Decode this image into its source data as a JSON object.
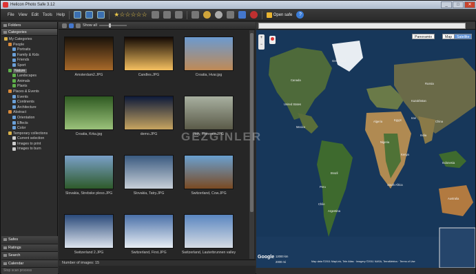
{
  "window": {
    "title": "Helicon Photo Safe 3.12",
    "buttons": [
      "_",
      "□",
      "✕"
    ]
  },
  "menu": [
    "File",
    "View",
    "Edit",
    "Tools",
    "Help"
  ],
  "toolbar": {
    "open_safe": "Open safe",
    "help": "?"
  },
  "left": {
    "folders_label": "Folders",
    "categories_label": "Categories",
    "tree": [
      {
        "label": "My Categories",
        "depth": 0,
        "color": "#d9b24a"
      },
      {
        "label": "People",
        "depth": 1,
        "color": "#d98a3a"
      },
      {
        "label": "Portraits",
        "depth": 2,
        "color": "#6aa0d8"
      },
      {
        "label": "Family & Kids",
        "depth": 2,
        "color": "#6aa0d8"
      },
      {
        "label": "Friends",
        "depth": 2,
        "color": "#6aa0d8"
      },
      {
        "label": "Sport",
        "depth": 2,
        "color": "#6aa0d8"
      },
      {
        "label": "Nature",
        "depth": 1,
        "color": "#5fb04a",
        "selected": true
      },
      {
        "label": "Landscapes",
        "depth": 2,
        "color": "#5fb04a"
      },
      {
        "label": "Animals",
        "depth": 2,
        "color": "#5fb04a"
      },
      {
        "label": "Plants",
        "depth": 2,
        "color": "#5fb04a"
      },
      {
        "label": "Places & Events",
        "depth": 1,
        "color": "#d98a3a"
      },
      {
        "label": "Events",
        "depth": 2,
        "color": "#6aa0d8"
      },
      {
        "label": "Continents",
        "depth": 2,
        "color": "#6aa0d8"
      },
      {
        "label": "Architecture",
        "depth": 2,
        "color": "#6aa0d8"
      },
      {
        "label": "Abstract",
        "depth": 1,
        "color": "#d98a3a"
      },
      {
        "label": "Orientation",
        "depth": 2,
        "color": "#6aa0d8"
      },
      {
        "label": "Effects",
        "depth": 2,
        "color": "#6aa0d8"
      },
      {
        "label": "Color",
        "depth": 2,
        "color": "#6aa0d8"
      },
      {
        "label": "Temporary collections",
        "depth": 1,
        "color": "#d9b24a"
      },
      {
        "label": "Current selection",
        "depth": 2,
        "color": "#cccccc"
      },
      {
        "label": "Images to print",
        "depth": 2,
        "color": "#cccccc"
      },
      {
        "label": "Images to burn",
        "depth": 2,
        "color": "#cccccc"
      }
    ],
    "bottom": [
      "Safes",
      "Ratings",
      "Search",
      "Calendar"
    ],
    "status": "Stop scan process"
  },
  "center": {
    "show_all": "Show all",
    "count_text": "Number of images: 15",
    "images": [
      {
        "caption": "Amsterdam2.JPG",
        "colors": [
          "#1a120a",
          "#a86a2a"
        ]
      },
      {
        "caption": "Candles.JPG",
        "colors": [
          "#120904",
          "#f5c060"
        ]
      },
      {
        "caption": "Croatia, Hvar.jpg",
        "colors": [
          "#6b9ad0",
          "#c08a55"
        ]
      },
      {
        "caption": "Croatia, Krka.jpg",
        "colors": [
          "#2f5a22",
          "#9bc27a"
        ]
      },
      {
        "caption": "demo.JPG",
        "colors": [
          "#0d1a3a",
          "#c7a560"
        ]
      },
      {
        "caption": "Italy, Florence.JPG",
        "colors": [
          "#a8b0a0",
          "#5a5a48"
        ]
      },
      {
        "caption": "Slovakia, Strebske pleso.JPG",
        "colors": [
          "#7aa0c8",
          "#2e5a2a"
        ]
      },
      {
        "caption": "Slovakia, Tatry.JPG",
        "colors": [
          "#3a5a80",
          "#c8d0d8"
        ]
      },
      {
        "caption": "Switzerland, Cow.JPG",
        "colors": [
          "#6aa0d0",
          "#7a4a22"
        ]
      },
      {
        "caption": "Switzerland 2.JPG",
        "colors": [
          "#2a4a7a",
          "#dde4ee"
        ]
      },
      {
        "caption": "Switzerland, First.JPG",
        "colors": [
          "#4a70a8",
          "#e8eef4"
        ]
      },
      {
        "caption": "Switzerland, Lauterbrunnen valley",
        "colors": [
          "#5a86c0",
          "#d6dce4"
        ]
      }
    ]
  },
  "map": {
    "panoramio": "Panoramio",
    "map_btn": "Map",
    "satellite_btn": "Satellite",
    "logo": "Google",
    "scale_km": "12000 km",
    "scale_mi": "2000 mi",
    "attribution": "Map data ©2011 MapLink, Tele Atlas · Imagery ©2011 NASA, TerraMetrics · Terms of Use",
    "labels": [
      {
        "t": "Greenland"
      },
      {
        "t": "Canada"
      },
      {
        "t": "United States"
      },
      {
        "t": "Mexico"
      },
      {
        "t": "Brazil"
      },
      {
        "t": "Peru"
      },
      {
        "t": "Argentina"
      },
      {
        "t": "Russia"
      },
      {
        "t": "China"
      },
      {
        "t": "India"
      },
      {
        "t": "Australia"
      },
      {
        "t": "Algeria"
      },
      {
        "t": "Egypt"
      },
      {
        "t": "Nigeria"
      },
      {
        "t": "Kenya"
      },
      {
        "t": "South Africa"
      },
      {
        "t": "Kazakhstan"
      },
      {
        "t": "Iran"
      },
      {
        "t": "Indonesia"
      },
      {
        "t": "Chile"
      }
    ]
  },
  "watermark": "GEZGINLER"
}
